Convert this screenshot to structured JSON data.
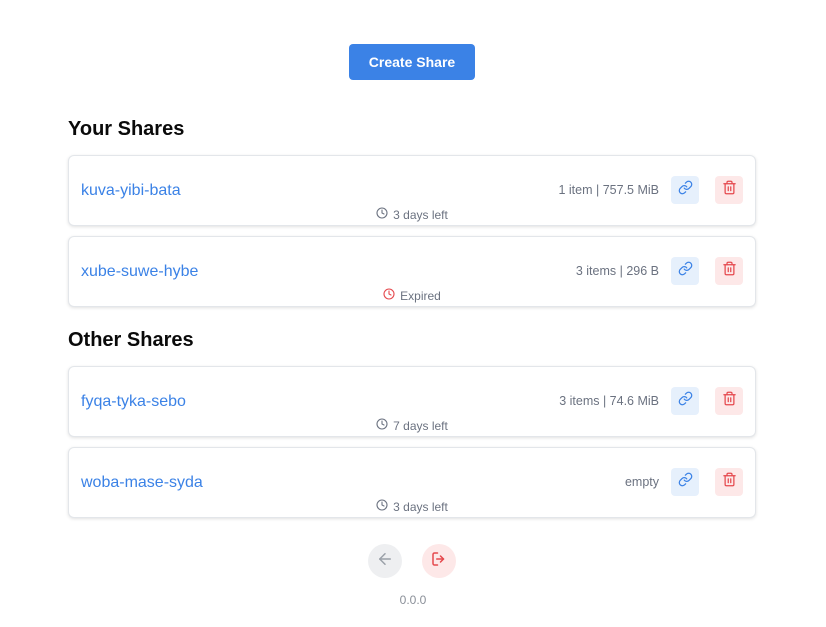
{
  "create_button_label": "Create Share",
  "your_shares": {
    "title": "Your Shares",
    "items": [
      {
        "name": "kuva-yibi-bata",
        "meta": "1 item | 757.5 MiB",
        "expiry": "3 days left",
        "expired": false
      },
      {
        "name": "xube-suwe-hybe",
        "meta": "3 items | 296 B",
        "expiry": "Expired",
        "expired": true
      }
    ]
  },
  "other_shares": {
    "title": "Other Shares",
    "items": [
      {
        "name": "fyqa-tyka-sebo",
        "meta": "3 items | 74.6 MiB",
        "expiry": "7 days left",
        "expired": false
      },
      {
        "name": "woba-mase-syda",
        "meta": "empty",
        "expiry": "3 days left",
        "expired": false
      }
    ]
  },
  "footer": {
    "back_icon": "arrow-left-icon",
    "logout_icon": "logout-icon",
    "version": "0.0.0"
  },
  "colors": {
    "accent": "#3b82e6",
    "danger": "#e5484d",
    "muted": "#6b7280"
  }
}
